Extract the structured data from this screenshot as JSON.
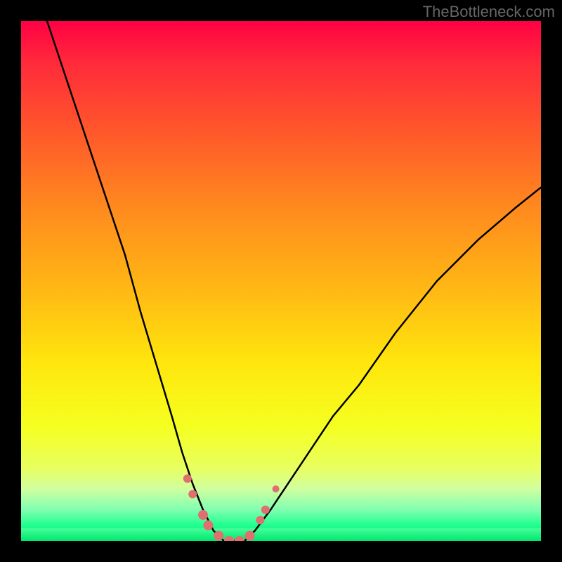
{
  "watermark": "TheBottleneck.com",
  "chart_data": {
    "type": "line",
    "title": "",
    "xlabel": "",
    "ylabel": "",
    "xlim": [
      0,
      100
    ],
    "ylim": [
      0,
      100
    ],
    "grid": false,
    "legend": false,
    "background_gradient": {
      "orientation": "vertical",
      "top_color": "#ff0044",
      "bottom_color": "#00e676"
    },
    "series": [
      {
        "name": "left-curve",
        "color": "#000000",
        "x": [
          5,
          10,
          15,
          20,
          23,
          26,
          29,
          31,
          33,
          35,
          36,
          37,
          38,
          39
        ],
        "values": [
          100,
          85,
          70,
          55,
          44,
          34,
          24,
          17,
          11,
          6,
          4,
          2,
          1,
          0
        ]
      },
      {
        "name": "right-curve",
        "color": "#000000",
        "x": [
          43,
          45,
          48,
          52,
          56,
          60,
          65,
          72,
          80,
          88,
          95,
          100
        ],
        "values": [
          0,
          2,
          6,
          12,
          18,
          24,
          30,
          40,
          50,
          58,
          64,
          68
        ]
      },
      {
        "name": "bottom-flat",
        "color": "#000000",
        "x": [
          39,
          40,
          41,
          42,
          43
        ],
        "values": [
          0,
          0,
          0,
          0,
          0
        ]
      }
    ],
    "markers": [
      {
        "x": 32,
        "y": 12,
        "color": "#e07070",
        "size": 12
      },
      {
        "x": 33,
        "y": 9,
        "color": "#e07070",
        "size": 12
      },
      {
        "x": 35,
        "y": 5,
        "color": "#e07070",
        "size": 14
      },
      {
        "x": 36,
        "y": 3,
        "color": "#e07070",
        "size": 14
      },
      {
        "x": 38,
        "y": 1,
        "color": "#e07070",
        "size": 14
      },
      {
        "x": 40,
        "y": 0,
        "color": "#e07070",
        "size": 14
      },
      {
        "x": 42,
        "y": 0,
        "color": "#e07070",
        "size": 14
      },
      {
        "x": 44,
        "y": 1,
        "color": "#e07070",
        "size": 14
      },
      {
        "x": 46,
        "y": 4,
        "color": "#e07070",
        "size": 12
      },
      {
        "x": 47,
        "y": 6,
        "color": "#e07070",
        "size": 12
      },
      {
        "x": 49,
        "y": 10,
        "color": "#e07070",
        "size": 10
      }
    ]
  }
}
